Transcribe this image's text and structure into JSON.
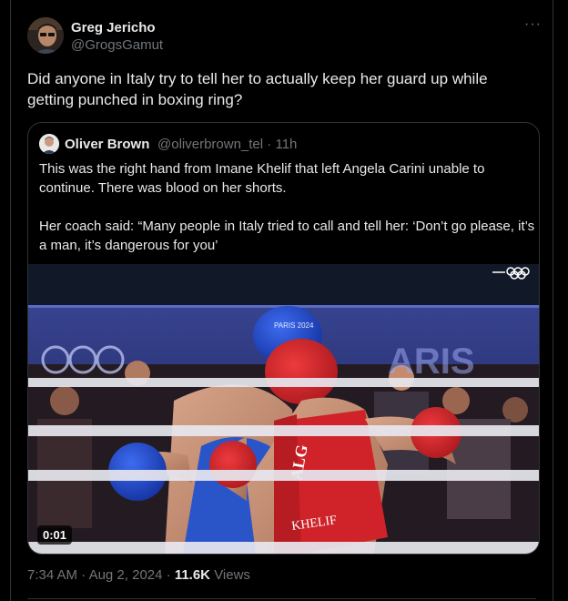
{
  "author": {
    "name": "Greg Jericho",
    "handle": "@GrogsGamut"
  },
  "post": {
    "text": "Did anyone in Italy try to tell her to actually keep her guard up while getting punched in boxing ring?",
    "time": "7:34 AM",
    "separator": "·",
    "date": "Aug 2, 2024",
    "views_count": "11.6K",
    "views_label": "Views"
  },
  "quoted": {
    "name": "Oliver Brown",
    "handle": "@oliverbrown_tel",
    "separator": "·",
    "age": "11h",
    "paragraph1": "This was the right hand from Imane Khelif that left Angela Carini unable to continue. There was blood on her shorts.",
    "paragraph2": "Her coach said: “Many people in Italy tried to call and tell her: ‘Don’t go please, it’s a man, it’s dangerous for you’",
    "video": {
      "timestamp": "0:01",
      "vest_letters": "ALG",
      "vest_name": "KHELIF",
      "headgear_text": "PARIS 2024"
    }
  },
  "icons": {
    "more": "more-dots-icon",
    "olympic": "olympic-rings-icon"
  },
  "colors": {
    "background": "#000000",
    "text_primary": "#e7e9ea",
    "text_secondary": "#71767b",
    "border": "#2f3336",
    "vest_red": "#d3262c",
    "glove_blue": "#1f49c9"
  }
}
